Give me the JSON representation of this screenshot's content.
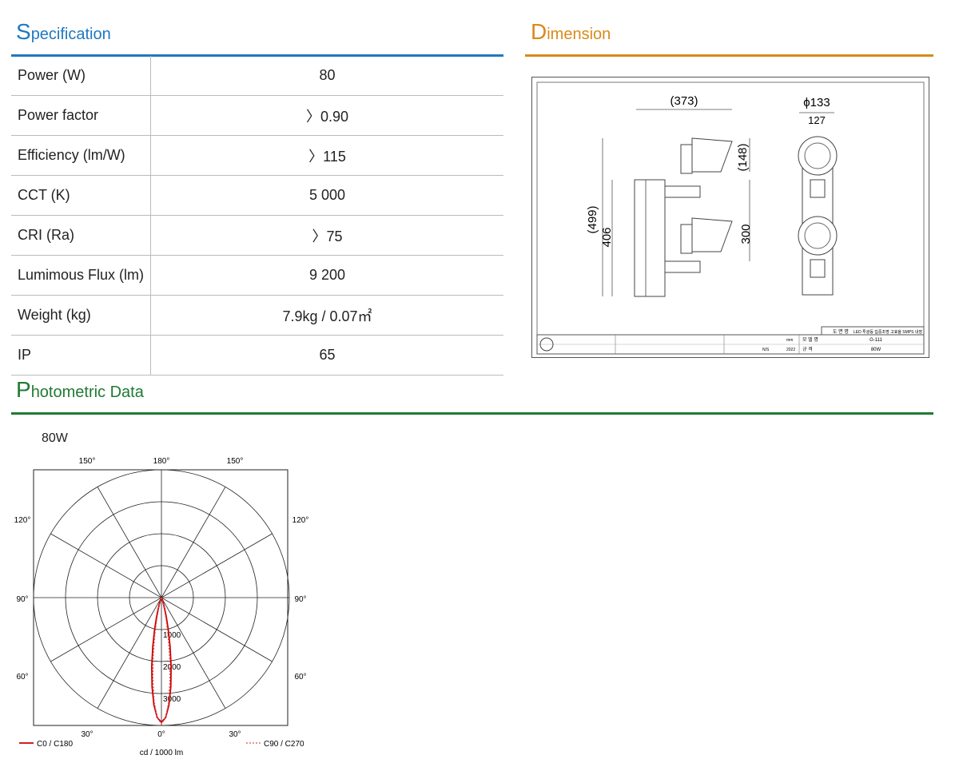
{
  "sections": {
    "spec_first": "S",
    "spec_rest": "pecification",
    "dim_first": "D",
    "dim_rest": "imension",
    "photo_first": "P",
    "photo_rest": "hotometric Data"
  },
  "colors": {
    "spec": "#1f78c1",
    "dimension": "#d98a1c",
    "photometric": "#1f7a34",
    "c0": "#cc0000",
    "c90": "#e05050"
  },
  "specs": [
    {
      "label": "Power (W)",
      "value": "80"
    },
    {
      "label": "Power factor",
      "value": "〉0.90"
    },
    {
      "label": "Efficiency (lm/W)",
      "value": "〉115"
    },
    {
      "label": "CCT (K)",
      "value": "5 000"
    },
    {
      "label": "CRI (Ra)",
      "value": "〉75"
    },
    {
      "label": "Lumimous Flux (lm)",
      "value": "9 200"
    },
    {
      "label": "Weight (kg)",
      "value": "7.9kg / 0.07㎡"
    },
    {
      "label": "IP",
      "value": "65"
    }
  ],
  "dimension": {
    "width": "(373)",
    "diameter": "ϕ133",
    "inner_width": "127",
    "head_height": "(148)",
    "total_height": "(499)",
    "body_height": "406",
    "spacing": "300",
    "title_block": {
      "product_label": "도 면 명",
      "product_name": "LED 투광등 집중조명 고효율 SMPS 내장",
      "code_label": "모 델 명",
      "code": "G-111",
      "spec_label": "규 격",
      "spec": "80W",
      "unit": "mm",
      "scale": "N/S",
      "year": "2022"
    }
  },
  "photometric": {
    "model_label": "80W",
    "top_angles": [
      "150°",
      "180°",
      "150°"
    ],
    "side_angles": [
      "120°",
      "90°",
      "60°"
    ],
    "bottom_angles": [
      "30°",
      "0°",
      "30°"
    ],
    "ring_labels": [
      "1000",
      "2000",
      "3000"
    ],
    "legend_c0": "C0 / C180",
    "legend_c90": "C90 / C270",
    "unit": "cd / 1000 lm"
  }
}
